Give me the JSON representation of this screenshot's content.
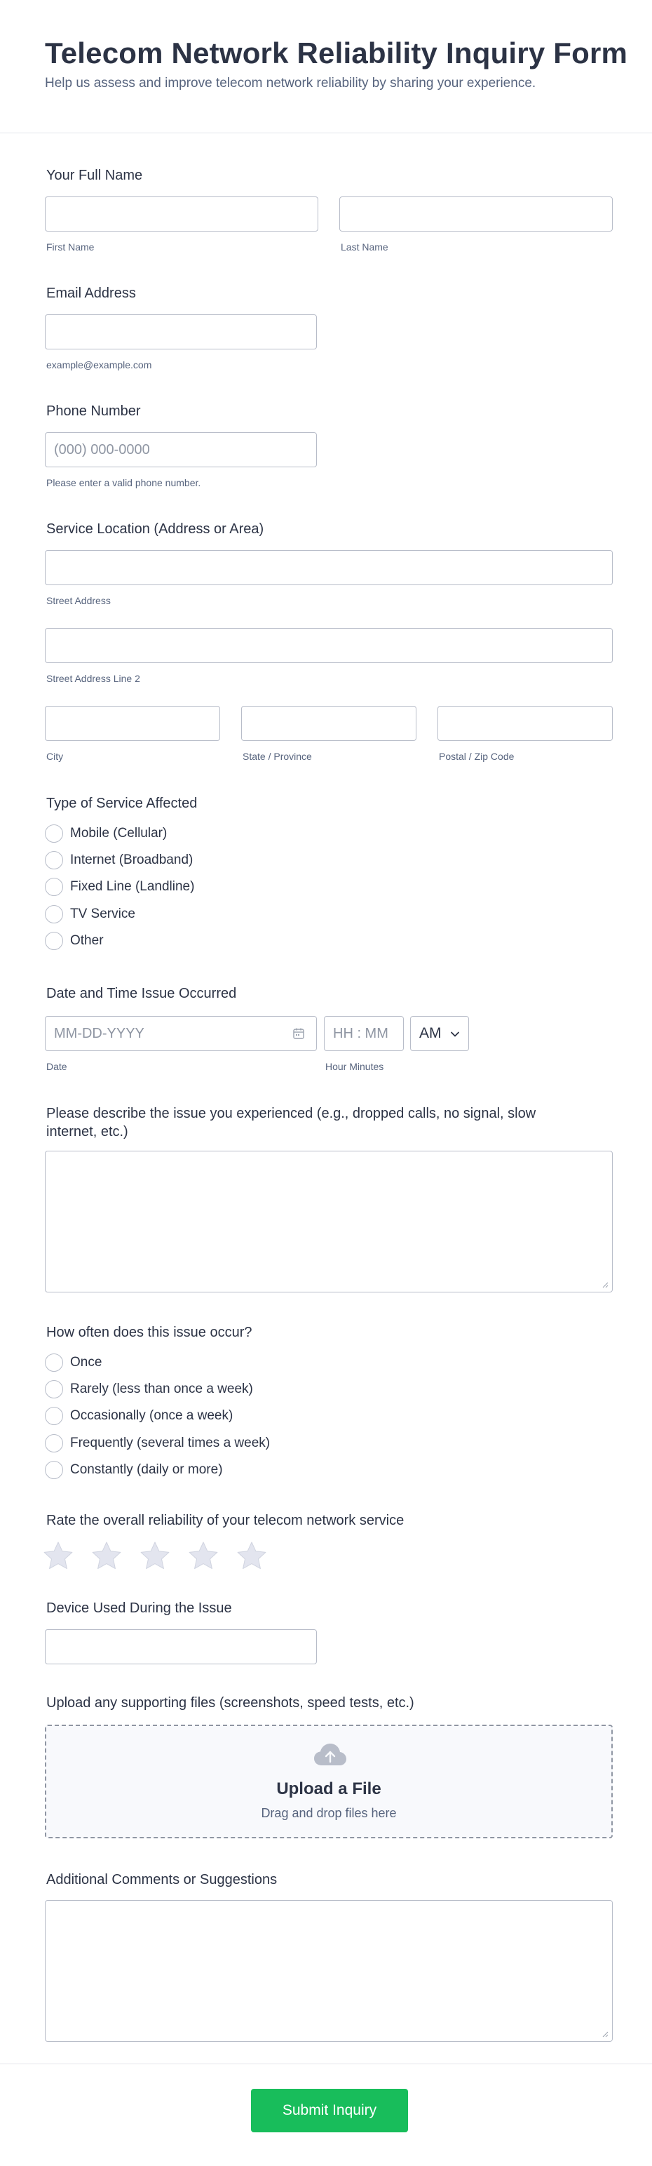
{
  "header": {
    "title": "Telecom Network Reliability Inquiry Form",
    "subtitle": "Help us assess and improve telecom network reliability by sharing your experience."
  },
  "full_name": {
    "label": "Your Full Name",
    "first_sublabel": "First Name",
    "last_sublabel": "Last Name",
    "first_value": "",
    "last_value": ""
  },
  "email": {
    "label": "Email Address",
    "value": "",
    "sublabel": "example@example.com"
  },
  "phone": {
    "label": "Phone Number",
    "placeholder": "(000) 000-0000",
    "value": "",
    "sublabel": "Please enter a valid phone number."
  },
  "address": {
    "label": "Service Location (Address or Area)",
    "street_sublabel": "Street Address",
    "street2_sublabel": "Street Address Line 2",
    "city_sublabel": "City",
    "state_sublabel": "State / Province",
    "postal_sublabel": "Postal / Zip Code"
  },
  "service_type": {
    "label": "Type of Service Affected",
    "options": [
      "Mobile (Cellular)",
      "Internet (Broadband)",
      "Fixed Line (Landline)",
      "TV Service",
      "Other"
    ],
    "selected": null
  },
  "datetime": {
    "label": "Date and Time Issue Occurred",
    "date_placeholder": "MM-DD-YYYY",
    "time_placeholder": "HH : MM",
    "ampm_value": "AM",
    "date_sublabel": "Date",
    "time_sublabel": "Hour Minutes",
    "calendar_icon": "calendar-icon",
    "dropdown_icon": "chevron-down-icon"
  },
  "issue_description": {
    "label": "Please describe the issue you experienced (e.g., dropped calls, no signal, slow internet, etc.)",
    "value": ""
  },
  "frequency": {
    "label": "How often does this issue occur?",
    "options": [
      "Once",
      "Rarely (less than once a week)",
      "Occasionally (once a week)",
      "Frequently (several times a week)",
      "Constantly (daily or more)"
    ],
    "selected": null
  },
  "rating": {
    "label": "Rate the overall reliability of your telecom network service",
    "max_stars": 5,
    "value": 0,
    "star_icon": "star-icon"
  },
  "device": {
    "label": "Device Used During the Issue",
    "value": ""
  },
  "upload": {
    "label": "Upload any supporting files (screenshots, speed tests, etc.)",
    "title": "Upload a File",
    "subtitle": "Drag and drop files here",
    "icon": "cloud-upload-icon"
  },
  "comments": {
    "label": "Additional Comments or Suggestions",
    "value": ""
  },
  "submit": {
    "label": "Submit Inquiry"
  },
  "colors": {
    "title_text": "#2c3345",
    "muted_text": "#57647e",
    "border": "#b8bdc9",
    "submit_bg": "#18bd5b",
    "star_fill": "#e3e5ef",
    "upload_bg": "#f8f9fc"
  }
}
